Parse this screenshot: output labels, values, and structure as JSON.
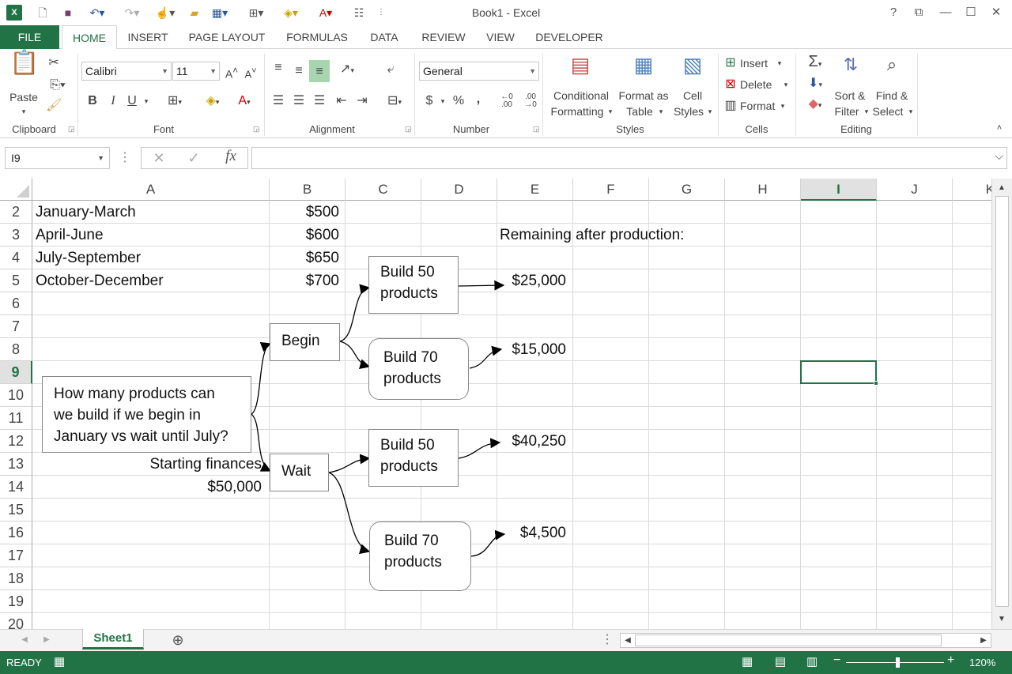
{
  "window": {
    "title": "Book1 - Excel",
    "help": "?"
  },
  "tabs": [
    "FILE",
    "HOME",
    "INSERT",
    "PAGE LAYOUT",
    "FORMULAS",
    "DATA",
    "REVIEW",
    "VIEW",
    "DEVELOPER"
  ],
  "ribbon": {
    "clipboard": {
      "paste": "Paste",
      "label": "Clipboard"
    },
    "font": {
      "name": "Calibri",
      "size": "11",
      "label": "Font",
      "bold": "B",
      "italic": "I",
      "underline": "U"
    },
    "alignment": {
      "label": "Alignment"
    },
    "number": {
      "format": "General",
      "label": "Number",
      "currency": "$",
      "percent": "%",
      "comma": ","
    },
    "styles": {
      "conditional1": "Conditional",
      "conditional2": "Formatting",
      "format_as1": "Format as",
      "format_as2": "Table",
      "cell1": "Cell",
      "cell2": "Styles",
      "label": "Styles"
    },
    "cells": {
      "insert": "Insert",
      "delete": "Delete",
      "format": "Format",
      "label": "Cells"
    },
    "editing": {
      "sort1": "Sort &",
      "sort2": "Filter",
      "find1": "Find &",
      "find2": "Select",
      "label": "Editing"
    }
  },
  "formula_bar": {
    "name_box": "I9",
    "fx": "fx",
    "value": ""
  },
  "columns": [
    "A",
    "B",
    "C",
    "D",
    "E",
    "F",
    "G",
    "H",
    "I",
    "J",
    "K"
  ],
  "rows": [
    "2",
    "3",
    "4",
    "5",
    "6",
    "7",
    "8",
    "9",
    "10",
    "11",
    "12",
    "13",
    "14",
    "15",
    "16",
    "17",
    "18",
    "19",
    "20"
  ],
  "cells": {
    "A2": "January-March",
    "A3": "April-June",
    "A4": "July-September",
    "A5": "October-December",
    "B2": "$500",
    "B3": "$600",
    "B4": "$650",
    "B5": "$700",
    "E3": "Remaining after production:",
    "A13": "Starting finances",
    "A14": "$50,000"
  },
  "diagram": {
    "question1": "How many products can",
    "question2": "we build if we begin in",
    "question3": "January vs wait until July?",
    "begin": "Begin",
    "wait": "Wait",
    "b50a_1": "Build 50",
    "b50a_2": "products",
    "b70a_1": "Build 70",
    "b70a_2": "products",
    "b50b_1": "Build 50",
    "b50b_2": "products",
    "b70b_1": "Build 70",
    "b70b_2": "products",
    "r1": "$25,000",
    "r2": "$15,000",
    "r3": "$40,250",
    "r4": "$4,500"
  },
  "sheet": {
    "name": "Sheet1"
  },
  "status": {
    "ready": "READY",
    "zoom": "120%"
  },
  "colors": {
    "accent": "#217346"
  }
}
